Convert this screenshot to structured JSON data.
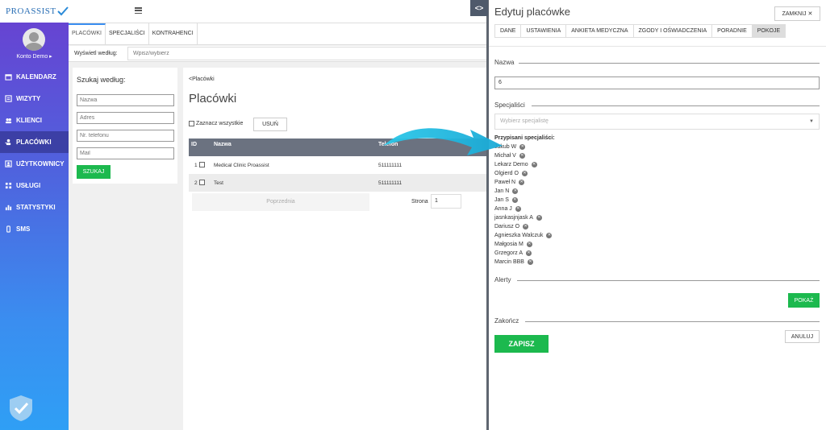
{
  "brand": {
    "logo_text": "PROASSIST"
  },
  "sidebar": {
    "account": "Konto Demo ▸",
    "items": [
      {
        "label": "KALENDARZ",
        "icon": "calendar-icon"
      },
      {
        "label": "WIZYTY",
        "icon": "list-icon"
      },
      {
        "label": "KLIENCI",
        "icon": "users-icon"
      },
      {
        "label": "PLACÓWKI",
        "icon": "user-plus-icon"
      },
      {
        "label": "UŻYTKOWNICY",
        "icon": "user-icon"
      },
      {
        "label": "USŁUGI",
        "icon": "grid-icon"
      },
      {
        "label": "STATYSTYKI",
        "icon": "bar-chart-icon"
      },
      {
        "label": "SMS",
        "icon": "phone-icon"
      }
    ],
    "active_index": 3
  },
  "tabs": [
    "PLACÓWKI",
    "SPECJALIŚCI",
    "KONTRAHENCI"
  ],
  "filter": {
    "label": "Wyświetl według:",
    "placeholder": "Wpisz/wybierz"
  },
  "search": {
    "title": "Szukaj według:",
    "fields": [
      "Nazwa",
      "Adres",
      "Nr. telefonu",
      "Mail"
    ],
    "button": "SZUKAJ"
  },
  "list": {
    "breadcrumb": "<Placówki",
    "title": "Placówki",
    "select_all": "Zaznacz wszystkie",
    "delete_button": "USUŃ",
    "columns": [
      "ID",
      "Nazwa",
      "Telefon"
    ],
    "rows": [
      {
        "id": "1",
        "name": "Medical Clinic Proassist",
        "phone": "511111111"
      },
      {
        "id": "2",
        "name": "Test",
        "phone": "511111111"
      }
    ],
    "prev": "Poprzednia",
    "page_label": "Strona",
    "page": "1"
  },
  "toggle_label": "<>",
  "panel": {
    "title": "Edytuj placówke",
    "close_button": "ZAMKNIJ ✕",
    "tabs": [
      "DANE",
      "USTAWIENIA",
      "ANKIETA MEDYCZNA",
      "ZGODY I OŚWIADCZENIA",
      "PORADNIE",
      "POKOJE"
    ],
    "active_tab": 5,
    "name_label": "Nazwa",
    "name_value": "6",
    "specialists_label": "Specjaliści",
    "specialists_placeholder": "Wybierz specjalistę",
    "assigned_label": "Przypisani specjaliści:",
    "specialists": [
      "Jakub W",
      "Michał V",
      "Lekarz Demo",
      "Olgierd O",
      "Paweł N",
      "Jan N",
      "Jan S",
      "Anna J",
      "jasnkasjnjask A",
      "Dariusz O",
      "Agnieszka Walczuk",
      "Małgosia M",
      "Grzegorz A",
      "Marcin BBB"
    ],
    "alerts_label": "Alerty",
    "show_button": "POKAŻ",
    "finish_label": "Zakończ",
    "cancel_button": "ANULUJ",
    "save_button": "ZAPISZ"
  },
  "colors": {
    "accent_green": "#1cb94e",
    "sidebar_top": "#6a3fd0",
    "sidebar_bottom": "#2f9ff5",
    "table_header": "#6b7280",
    "arrow": "#29c5e6"
  }
}
